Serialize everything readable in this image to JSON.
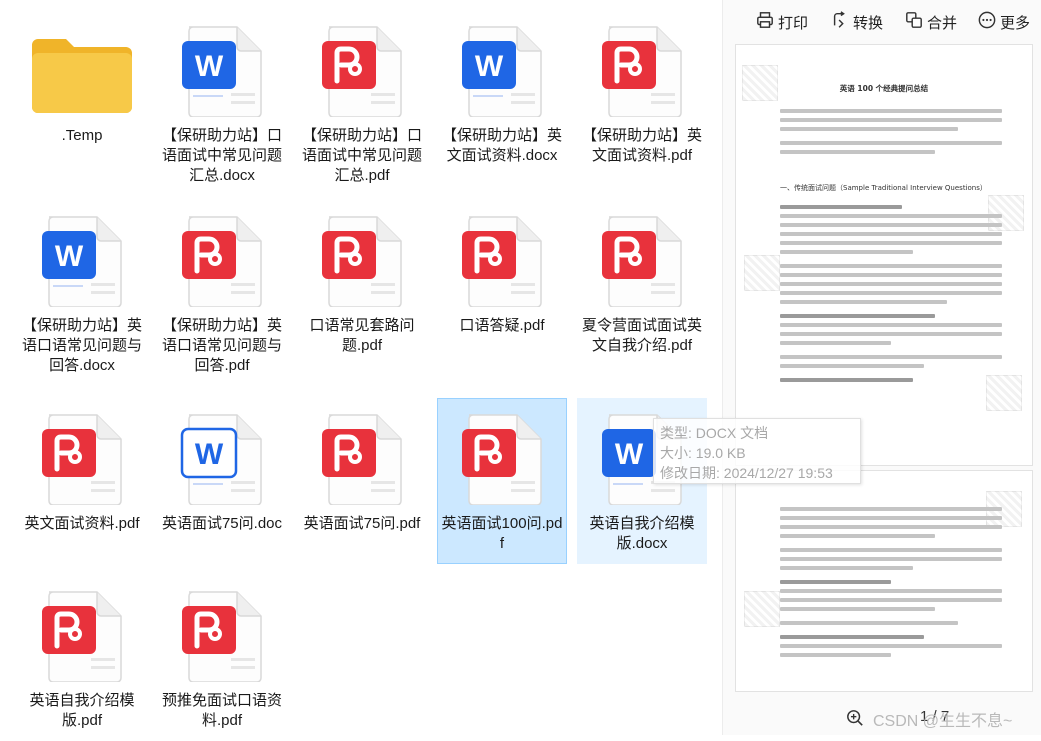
{
  "files": [
    {
      "name": ".Temp",
      "type": "folder"
    },
    {
      "name": "【保研助力站】口语面试中常见问题汇总.docx",
      "type": "word"
    },
    {
      "name": "【保研助力站】口语面试中常见问题汇总.pdf",
      "type": "pdf"
    },
    {
      "name": "【保研助力站】英文面试资料.docx",
      "type": "word"
    },
    {
      "name": "【保研助力站】英文面试资料.pdf",
      "type": "pdf"
    },
    {
      "name": "【保研助力站】英语口语常见问题与回答.docx",
      "type": "word"
    },
    {
      "name": "【保研助力站】英语口语常见问题与回答.pdf",
      "type": "pdf"
    },
    {
      "name": "口语常见套路问题.pdf",
      "type": "pdf"
    },
    {
      "name": "口语答疑.pdf",
      "type": "pdf"
    },
    {
      "name": "夏令营面试面试英文自我介绍.pdf",
      "type": "pdf"
    },
    {
      "name": "英文面试资料.pdf",
      "type": "pdf"
    },
    {
      "name": "英语面试75问.doc",
      "type": "word-outline"
    },
    {
      "name": "英语面试75问.pdf",
      "type": "pdf"
    },
    {
      "name": "英语面试100问.pdf",
      "type": "pdf",
      "state": "selected"
    },
    {
      "name": "英语自我介绍模版.docx",
      "type": "word",
      "state": "hover"
    },
    {
      "name": "英语自我介绍模版.pdf",
      "type": "pdf"
    },
    {
      "name": "预推免面试口语资料.pdf",
      "type": "pdf"
    }
  ],
  "toolbar": {
    "print": "打印",
    "convert": "转换",
    "merge": "合并",
    "more": "更多"
  },
  "preview": {
    "doc_title": "英语 100 个经典提问总结",
    "doc_heading": "一、传统面试问题（Sample Traditional Interview Questions）",
    "page_indicator": "1 / 7",
    "watermark": "CSDN @生生不息~"
  },
  "tooltip": {
    "type": "类型: DOCX 文档",
    "size": "大小: 19.0 KB",
    "modified": "修改日期: 2024/12/27 19:53"
  },
  "colors": {
    "word_blue": "#1f66e5",
    "pdf_red": "#e8323c",
    "folder_yellow": "#f7c948",
    "selected_bg": "#cce8ff"
  }
}
